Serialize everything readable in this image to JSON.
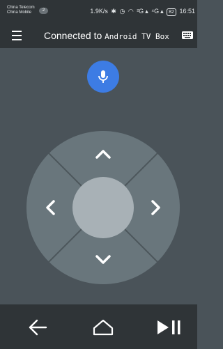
{
  "status_bar": {
    "carrier_1": "China Telecom",
    "carrier_2": "China Mobile",
    "notification_count": "2",
    "speed": "1.9K/s",
    "network_1": "²G",
    "network_2": "⁴G",
    "battery": "82",
    "time": "16:51"
  },
  "header": {
    "title_prefix": "Connected to ",
    "device_name": "Android TV Box"
  },
  "icons": {
    "menu": "menu-icon",
    "keyboard": "keyboard-icon",
    "mic": "mic-icon",
    "up": "chevron-up-icon",
    "down": "chevron-down-icon",
    "left": "chevron-left-icon",
    "right": "chevron-right-icon",
    "back": "back-arrow-icon",
    "home": "home-icon",
    "play_pause": "play-pause-icon"
  },
  "colors": {
    "background": "#4a5359",
    "bars": "#2f3437",
    "dpad_ring": "#69767c",
    "dpad_center": "#a8b1b6",
    "mic_accent": "#3d7ce4"
  }
}
